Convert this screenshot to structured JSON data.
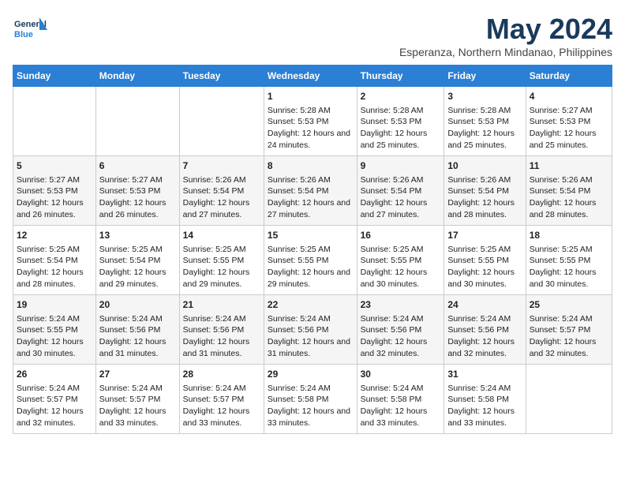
{
  "header": {
    "logo_line1": "General",
    "logo_line2": "Blue",
    "month_title": "May 2024",
    "location": "Esperanza, Northern Mindanao, Philippines"
  },
  "days_of_week": [
    "Sunday",
    "Monday",
    "Tuesday",
    "Wednesday",
    "Thursday",
    "Friday",
    "Saturday"
  ],
  "weeks": [
    [
      {
        "day": "",
        "empty": true
      },
      {
        "day": "",
        "empty": true
      },
      {
        "day": "",
        "empty": true
      },
      {
        "day": "1",
        "sunrise": "5:28 AM",
        "sunset": "5:53 PM",
        "daylight": "12 hours and 24 minutes."
      },
      {
        "day": "2",
        "sunrise": "5:28 AM",
        "sunset": "5:53 PM",
        "daylight": "12 hours and 25 minutes."
      },
      {
        "day": "3",
        "sunrise": "5:28 AM",
        "sunset": "5:53 PM",
        "daylight": "12 hours and 25 minutes."
      },
      {
        "day": "4",
        "sunrise": "5:27 AM",
        "sunset": "5:53 PM",
        "daylight": "12 hours and 25 minutes."
      }
    ],
    [
      {
        "day": "5",
        "sunrise": "5:27 AM",
        "sunset": "5:53 PM",
        "daylight": "12 hours and 26 minutes."
      },
      {
        "day": "6",
        "sunrise": "5:27 AM",
        "sunset": "5:53 PM",
        "daylight": "12 hours and 26 minutes."
      },
      {
        "day": "7",
        "sunrise": "5:26 AM",
        "sunset": "5:54 PM",
        "daylight": "12 hours and 27 minutes."
      },
      {
        "day": "8",
        "sunrise": "5:26 AM",
        "sunset": "5:54 PM",
        "daylight": "12 hours and 27 minutes."
      },
      {
        "day": "9",
        "sunrise": "5:26 AM",
        "sunset": "5:54 PM",
        "daylight": "12 hours and 27 minutes."
      },
      {
        "day": "10",
        "sunrise": "5:26 AM",
        "sunset": "5:54 PM",
        "daylight": "12 hours and 28 minutes."
      },
      {
        "day": "11",
        "sunrise": "5:26 AM",
        "sunset": "5:54 PM",
        "daylight": "12 hours and 28 minutes."
      }
    ],
    [
      {
        "day": "12",
        "sunrise": "5:25 AM",
        "sunset": "5:54 PM",
        "daylight": "12 hours and 28 minutes."
      },
      {
        "day": "13",
        "sunrise": "5:25 AM",
        "sunset": "5:54 PM",
        "daylight": "12 hours and 29 minutes."
      },
      {
        "day": "14",
        "sunrise": "5:25 AM",
        "sunset": "5:55 PM",
        "daylight": "12 hours and 29 minutes."
      },
      {
        "day": "15",
        "sunrise": "5:25 AM",
        "sunset": "5:55 PM",
        "daylight": "12 hours and 29 minutes."
      },
      {
        "day": "16",
        "sunrise": "5:25 AM",
        "sunset": "5:55 PM",
        "daylight": "12 hours and 30 minutes."
      },
      {
        "day": "17",
        "sunrise": "5:25 AM",
        "sunset": "5:55 PM",
        "daylight": "12 hours and 30 minutes."
      },
      {
        "day": "18",
        "sunrise": "5:25 AM",
        "sunset": "5:55 PM",
        "daylight": "12 hours and 30 minutes."
      }
    ],
    [
      {
        "day": "19",
        "sunrise": "5:24 AM",
        "sunset": "5:55 PM",
        "daylight": "12 hours and 30 minutes."
      },
      {
        "day": "20",
        "sunrise": "5:24 AM",
        "sunset": "5:56 PM",
        "daylight": "12 hours and 31 minutes."
      },
      {
        "day": "21",
        "sunrise": "5:24 AM",
        "sunset": "5:56 PM",
        "daylight": "12 hours and 31 minutes."
      },
      {
        "day": "22",
        "sunrise": "5:24 AM",
        "sunset": "5:56 PM",
        "daylight": "12 hours and 31 minutes."
      },
      {
        "day": "23",
        "sunrise": "5:24 AM",
        "sunset": "5:56 PM",
        "daylight": "12 hours and 32 minutes."
      },
      {
        "day": "24",
        "sunrise": "5:24 AM",
        "sunset": "5:56 PM",
        "daylight": "12 hours and 32 minutes."
      },
      {
        "day": "25",
        "sunrise": "5:24 AM",
        "sunset": "5:57 PM",
        "daylight": "12 hours and 32 minutes."
      }
    ],
    [
      {
        "day": "26",
        "sunrise": "5:24 AM",
        "sunset": "5:57 PM",
        "daylight": "12 hours and 32 minutes."
      },
      {
        "day": "27",
        "sunrise": "5:24 AM",
        "sunset": "5:57 PM",
        "daylight": "12 hours and 33 minutes."
      },
      {
        "day": "28",
        "sunrise": "5:24 AM",
        "sunset": "5:57 PM",
        "daylight": "12 hours and 33 minutes."
      },
      {
        "day": "29",
        "sunrise": "5:24 AM",
        "sunset": "5:58 PM",
        "daylight": "12 hours and 33 minutes."
      },
      {
        "day": "30",
        "sunrise": "5:24 AM",
        "sunset": "5:58 PM",
        "daylight": "12 hours and 33 minutes."
      },
      {
        "day": "31",
        "sunrise": "5:24 AM",
        "sunset": "5:58 PM",
        "daylight": "12 hours and 33 minutes."
      },
      {
        "day": "",
        "empty": true
      }
    ]
  ]
}
